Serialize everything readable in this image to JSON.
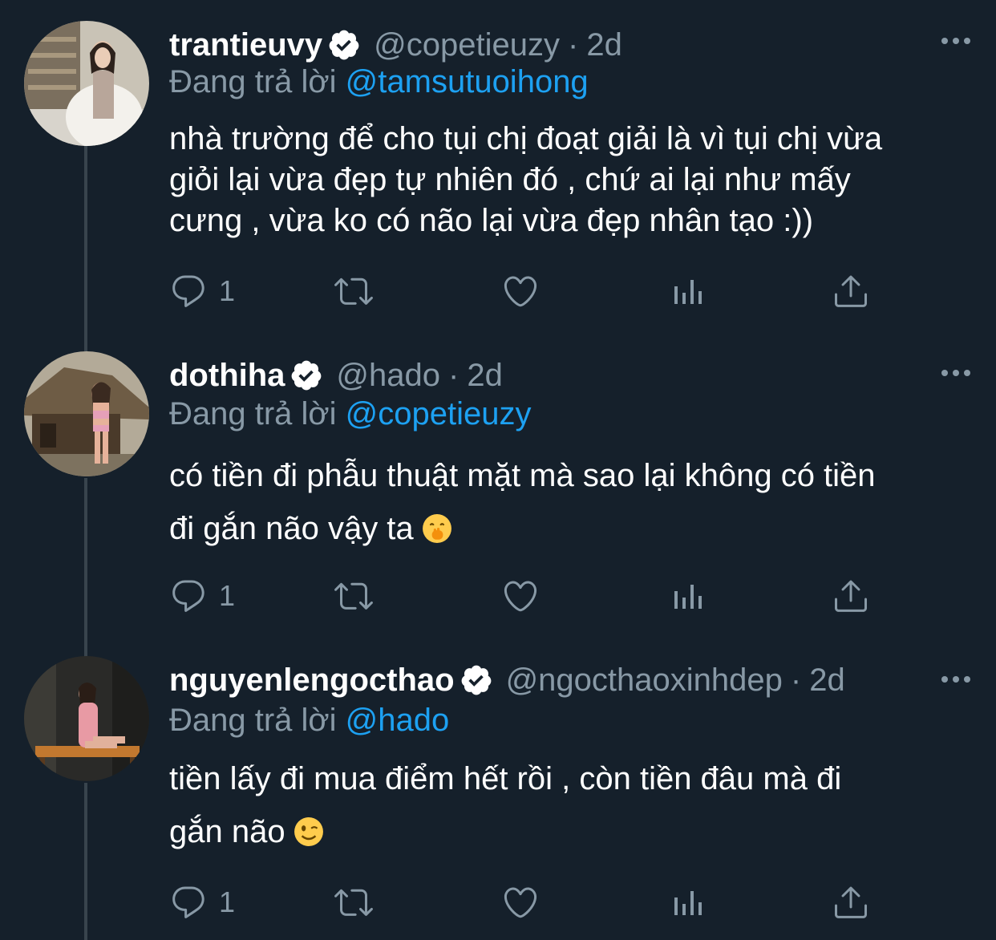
{
  "tweets": [
    {
      "name": "trantieuvy",
      "handle": "@copetieuzy",
      "separator": "·",
      "time": "2d",
      "replying_label": "Đang trả lời",
      "replying_to": "@tamsutuoihong",
      "body_lines": [
        "nhà trường để cho tụi chị đoạt giải là vì tụi chị vừa",
        "giỏi lại vừa đẹp tự nhiên đó , chứ ai lại như mấy",
        "cưng , vừa ko có não lại vừa đẹp nhân tạo :))"
      ],
      "reply_count": "1",
      "emoji": null
    },
    {
      "name": "dothiha",
      "handle": "@hado",
      "separator": "·",
      "time": "2d",
      "replying_label": "Đang trả lời",
      "replying_to": "@copetieuzy",
      "body_lines": [
        "có tiền đi phẫu thuật mặt mà sao lại không có tiền",
        "đi gắn não vậy ta"
      ],
      "reply_count": "1",
      "emoji": "hand-over-mouth-emoji"
    },
    {
      "name": "nguyenlengocthao",
      "handle": "@ngocthaoxinhdep",
      "separator": "·",
      "time": "2d",
      "replying_label": "Đang trả lời",
      "replying_to": "@hado",
      "body_lines": [
        "tiền lấy đi mua điểm hết rồi , còn tiền đâu mà đi",
        "gắn não"
      ],
      "reply_count": "1",
      "emoji": "winking-face-emoji"
    }
  ],
  "colors": {
    "background": "#15202b",
    "secondary_text": "#8899a6",
    "mention": "#1da1f2",
    "thread_line": "#38444d",
    "verified_badge": "#ffffff"
  }
}
